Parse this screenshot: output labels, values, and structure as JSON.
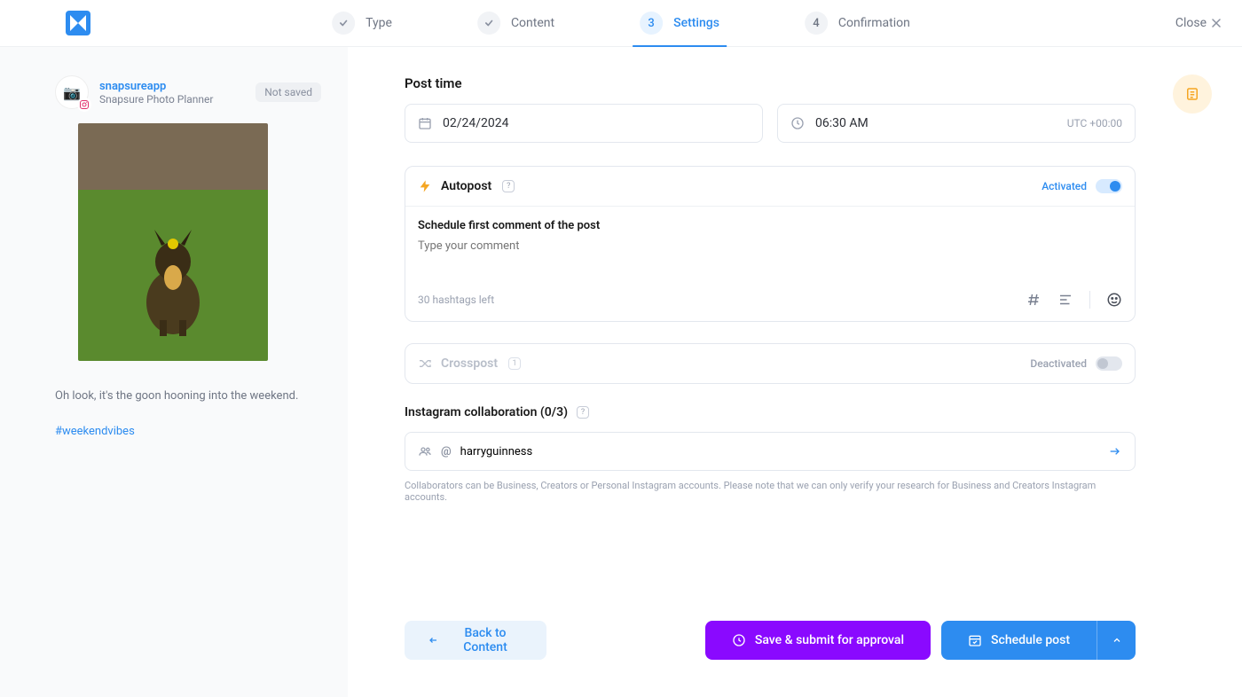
{
  "header": {
    "close_label": "Close",
    "steps": [
      {
        "num": "✓",
        "label": "Type",
        "state": "done"
      },
      {
        "num": "✓",
        "label": "Content",
        "state": "done"
      },
      {
        "num": "3",
        "label": "Settings",
        "state": "active"
      },
      {
        "num": "4",
        "label": "Confirmation",
        "state": "pending"
      }
    ]
  },
  "sidebar": {
    "account_handle": "snapsureapp",
    "account_name": "Snapsure Photo Planner",
    "save_badge": "Not saved",
    "caption": "Oh look, it's the goon hooning into the weekend.",
    "hashtag": "#weekendvibes"
  },
  "settings": {
    "post_time_title": "Post time",
    "date_value": "02/24/2024",
    "time_value": "06:30 AM",
    "timezone": "UTC +00:00",
    "autopost": {
      "title": "Autopost",
      "status_label": "Activated",
      "comment_title": "Schedule first comment of the post",
      "comment_placeholder": "Type your comment",
      "hashtags_left": "30 hashtags left"
    },
    "crosspost": {
      "title": "Crosspost",
      "badge": "1",
      "status_label": "Deactivated"
    },
    "collab": {
      "title": "Instagram collaboration (0/3)",
      "at_prefix": "@",
      "input_value": "harryguinness",
      "note": "Collaborators can be Business, Creators or Personal Instagram accounts. Please note that we can only verify your research for Business and Creators Instagram accounts."
    }
  },
  "footer": {
    "back_label": "Back to Content",
    "approval_label": "Save & submit for approval",
    "schedule_label": "Schedule post"
  }
}
